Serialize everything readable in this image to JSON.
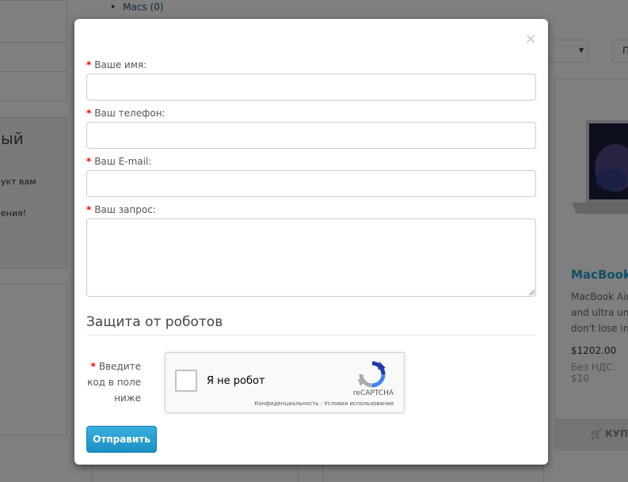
{
  "background": {
    "category_link": "Macs (0)",
    "left_heading_fragment": "ый",
    "left_text_1": "укт вам",
    "left_text_2": "ения!",
    "select_arrow": "▾",
    "top_button": "П",
    "product": {
      "title": "MacBook",
      "description": "MacBook Air\nand ultra unl\ndon't lose in.",
      "price": "$1202.00",
      "price_ex_tax": "Без НДС: $10",
      "buy_label": "КУПИ"
    }
  },
  "modal": {
    "close": "×",
    "fields": {
      "name_label": "Ваше имя:",
      "phone_label": "Ваш телефон:",
      "email_label": "Ваш E-mail:",
      "request_label": "Ваш запрос:"
    },
    "required_mark": "*",
    "section_title": "Защита от роботов",
    "captcha_label_1": "Введите",
    "captcha_label_2": "код в поле",
    "captcha_label_3": "ниже",
    "recaptcha": {
      "checkbox_text": "Я не робот",
      "brand": "reCAPTCHA",
      "links": "Конфиденциальность - Условия использования"
    },
    "submit_label": "Отправить"
  },
  "colors": {
    "required": "#ff0000",
    "submit": "#1a8fc4",
    "link": "#23a1d1"
  }
}
